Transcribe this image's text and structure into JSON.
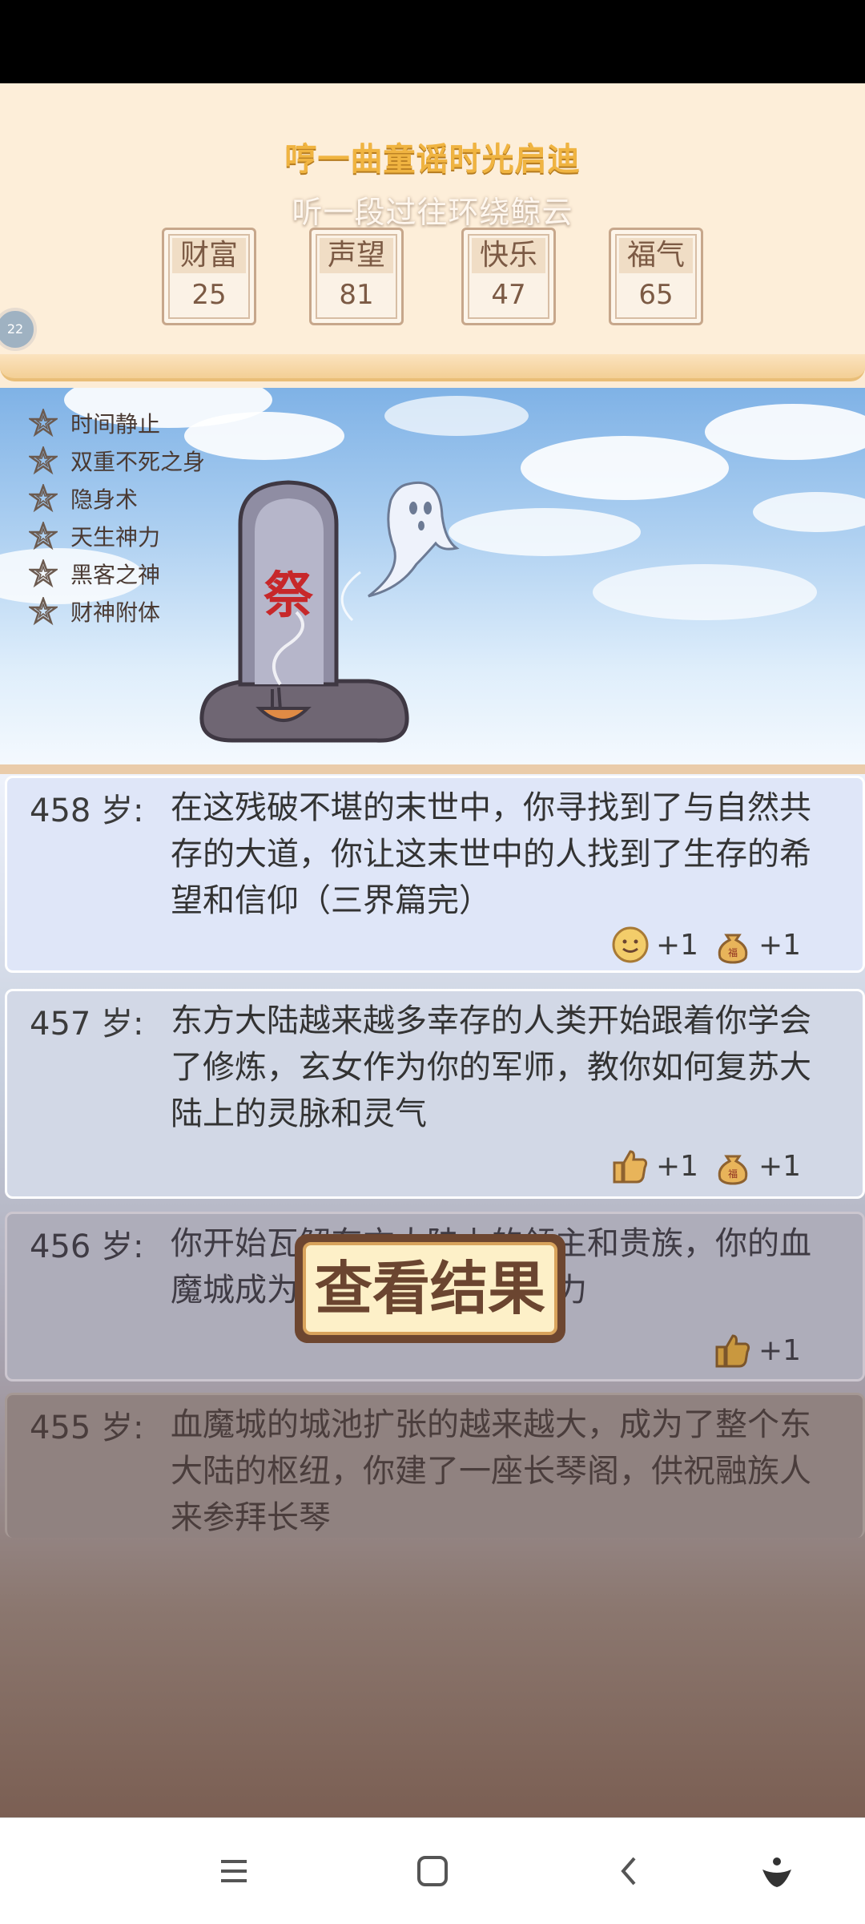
{
  "header": {
    "title_line1": "哼一曲童谣时光启迪",
    "title_line2": "听一段过往环绕鲸云"
  },
  "stats": [
    {
      "label": "财富",
      "value": "25"
    },
    {
      "label": "声望",
      "value": "81"
    },
    {
      "label": "快乐",
      "value": "47"
    },
    {
      "label": "福气",
      "value": "65"
    }
  ],
  "side_badge": "22",
  "abilities": [
    "时间静止",
    "双重不死之身",
    "隐身术",
    "天生神力",
    "黑客之神",
    "财神附体"
  ],
  "tombstone_char": "祭",
  "events": [
    {
      "age": "458 岁:",
      "text": "在这残破不堪的末世中，你寻找到了与自然共存的大道，你让这末世中的人找到了生存的希望和信仰（三界篇完）",
      "rewards": [
        {
          "icon": "smile-icon",
          "text": "+1"
        },
        {
          "icon": "fortune-bag-icon",
          "text": "+1"
        }
      ]
    },
    {
      "age": "457 岁:",
      "text": "东方大陆越来越多幸存的人类开始跟着你学会了修炼，玄女作为你的军师，教你如何复苏大陆上的灵脉和灵气",
      "rewards": [
        {
          "icon": "thumbs-up-icon",
          "text": "+1"
        },
        {
          "icon": "fortune-bag-icon",
          "text": "+1"
        }
      ]
    },
    {
      "age": "456 岁:",
      "text": "你开始瓦解东方大陆上的领主和贵族，你的血魔城成为了大陆上的唯一势力",
      "rewards": [
        {
          "icon": "thumbs-up-icon",
          "text": "+1"
        }
      ]
    },
    {
      "age": "455 岁:",
      "text": "血魔城的城池扩张的越来越大，成为了整个东大陆的枢纽，你建了一座长琴阁，供祝融族人来参拜长琴",
      "rewards": []
    }
  ],
  "result_button": "查看结果",
  "colors": {
    "gold_title": "#f0b441",
    "brown": "#6d4630"
  }
}
